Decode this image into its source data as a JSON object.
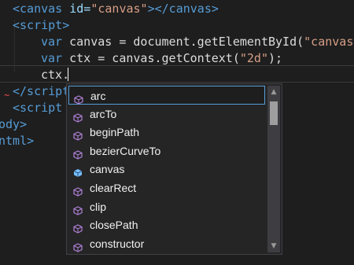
{
  "code": {
    "line1": {
      "open_tag": "<canvas",
      "attr": " id=",
      "value": "\"canvas\"",
      "close": "></canvas>"
    },
    "line2": {
      "tag": "<script>"
    },
    "line3": {
      "kw": "var",
      "rest": " canvas = document.getElementById(",
      "str": "\"canvas\""
    },
    "line4": {
      "kw": "var",
      "rest": " ctx = canvas.getContext(",
      "str": "\"2d\"",
      "end": ");"
    },
    "line5": {
      "text": "ctx."
    },
    "line6": {
      "tag": "</script"
    },
    "line7": {
      "tag": "<script"
    },
    "line8": {
      "tag": "ody>"
    },
    "line9": {
      "tag": "ntml>"
    }
  },
  "autocomplete": {
    "items": [
      {
        "label": "arc",
        "icon": "method-cube-icon",
        "selected": true
      },
      {
        "label": "arcTo",
        "icon": "method-cube-icon",
        "selected": false
      },
      {
        "label": "beginPath",
        "icon": "method-cube-icon",
        "selected": false
      },
      {
        "label": "bezierCurveTo",
        "icon": "method-cube-icon",
        "selected": false
      },
      {
        "label": "canvas",
        "icon": "property-icon",
        "selected": false
      },
      {
        "label": "clearRect",
        "icon": "method-cube-icon",
        "selected": false
      },
      {
        "label": "clip",
        "icon": "method-cube-icon",
        "selected": false
      },
      {
        "label": "closePath",
        "icon": "method-cube-icon",
        "selected": false
      },
      {
        "label": "constructor",
        "icon": "method-cube-icon",
        "selected": false
      }
    ]
  },
  "colors": {
    "background": "#1e1e1e",
    "method_icon": "#b180d7",
    "property_icon": "#75beff",
    "selection_border": "#569cd6"
  }
}
